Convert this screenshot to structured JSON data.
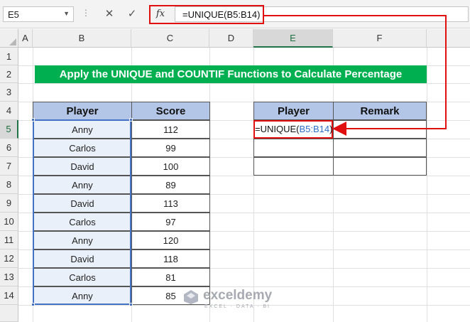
{
  "formula_bar": {
    "name_box": "E5",
    "dots": "⋮",
    "cancel_glyph": "✕",
    "enter_glyph": "✓",
    "fx_label": "fx",
    "formula": "=UNIQUE(B5:B14)"
  },
  "columns": [
    "A",
    "B",
    "C",
    "D",
    "E",
    "F"
  ],
  "rows": [
    "1",
    "2",
    "3",
    "4",
    "5",
    "6",
    "7",
    "8",
    "9",
    "10",
    "11",
    "12",
    "13",
    "14"
  ],
  "title": "Apply the UNIQUE and COUNTIF Functions to Calculate Percentage",
  "left_table": {
    "headers": [
      "Player",
      "Score"
    ],
    "rows": [
      [
        "Anny",
        "112"
      ],
      [
        "Carlos",
        "99"
      ],
      [
        "David",
        "100"
      ],
      [
        "Anny",
        "89"
      ],
      [
        "David",
        "113"
      ],
      [
        "Carlos",
        "97"
      ],
      [
        "Anny",
        "120"
      ],
      [
        "David",
        "118"
      ],
      [
        "Carlos",
        "81"
      ],
      [
        "Anny",
        "85"
      ]
    ]
  },
  "right_table": {
    "headers": [
      "Player",
      "Remark"
    ],
    "formula_prefix": "=UNIQUE(",
    "formula_ref": "B5:B14",
    "formula_suffix": ")"
  },
  "watermark": {
    "name": "exceldemy",
    "tagline": "EXCEL · DATA · BI"
  },
  "colors": {
    "title_bg": "#00b050",
    "header_bg": "#b4c6e7",
    "highlight": "#e01010",
    "selection": "#4472c4"
  },
  "icons": {
    "name_box_dropdown": "chevron-down-icon",
    "cancel": "close-icon",
    "enter": "check-icon",
    "function": "fx-icon"
  }
}
